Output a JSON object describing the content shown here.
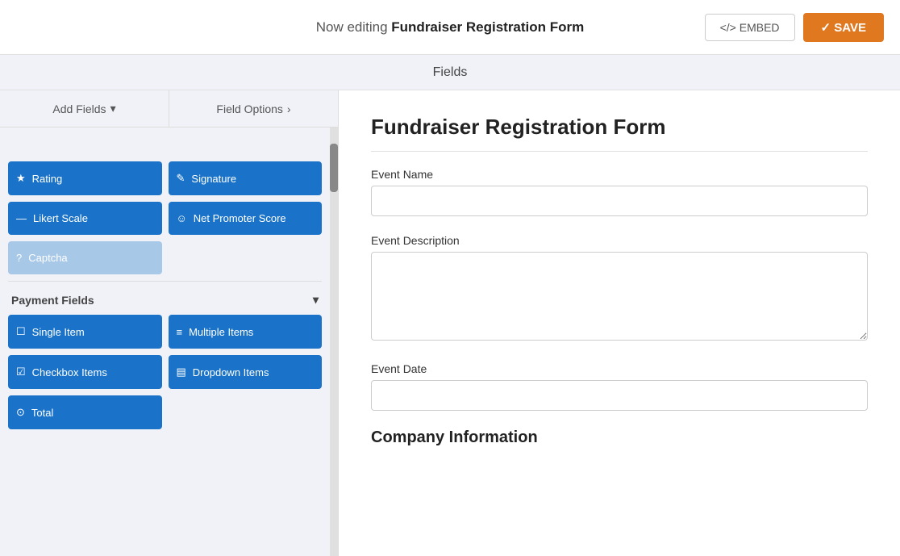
{
  "topBar": {
    "editingLabel": "Now editing",
    "formName": "Fundraiser Registration Form",
    "embedLabel": "</>  EMBED",
    "saveLabel": "✓  SAVE"
  },
  "fieldsBar": {
    "label": "Fields"
  },
  "leftPanel": {
    "addFieldsTab": "Add Fields",
    "addFieldsChevron": "▾",
    "fieldOptionsTab": "Field Options",
    "fieldOptionsChevron": "›",
    "fieldButtons": [
      {
        "icon": "★",
        "label": "Rating"
      },
      {
        "icon": "✎",
        "label": "Signature"
      },
      {
        "icon": "—",
        "label": "Likert Scale"
      },
      {
        "icon": "☺",
        "label": "Net Promoter Score"
      },
      {
        "icon": "?",
        "label": "Captcha"
      }
    ],
    "paymentSection": "Payment Fields",
    "paymentChevron": "▾",
    "paymentButtons": [
      {
        "icon": "☐",
        "label": "Single Item"
      },
      {
        "icon": "≡",
        "label": "Multiple Items"
      },
      {
        "icon": "☑",
        "label": "Checkbox Items"
      },
      {
        "icon": "▤",
        "label": "Dropdown Items"
      },
      {
        "icon": "⊙",
        "label": "Total"
      }
    ]
  },
  "rightPanel": {
    "formTitle": "Fundraiser Registration Form",
    "fields": [
      {
        "label": "Event Name",
        "type": "input",
        "placeholder": ""
      },
      {
        "label": "Event Description",
        "type": "textarea",
        "placeholder": ""
      },
      {
        "label": "Event Date",
        "type": "input",
        "placeholder": ""
      }
    ],
    "sectionHeading": "Company Information"
  }
}
